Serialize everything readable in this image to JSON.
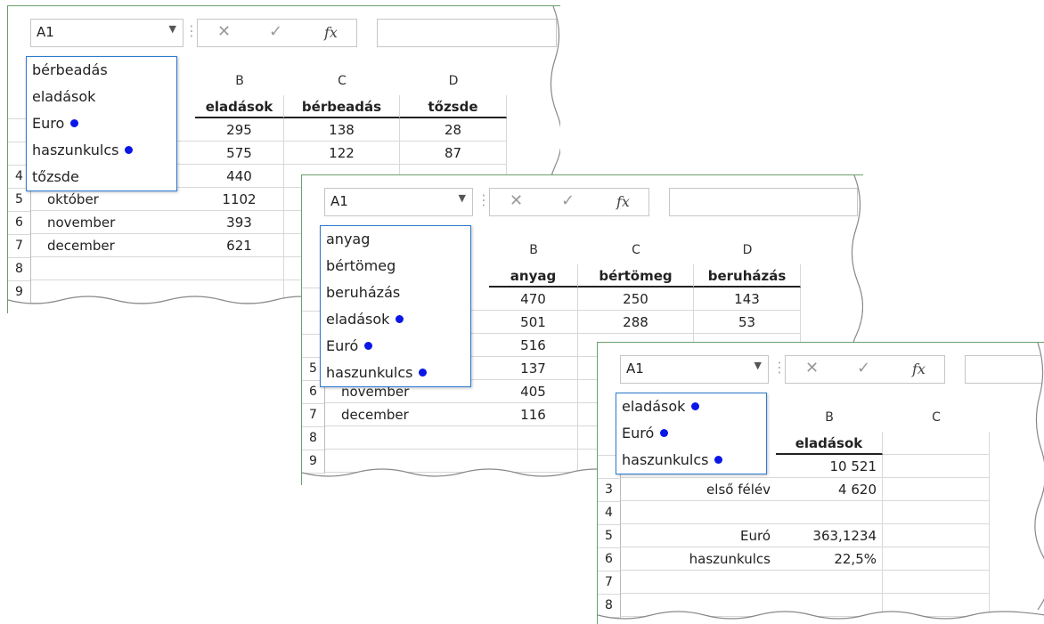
{
  "sheets": [
    {
      "namebox": "A1",
      "fx_label": "fx",
      "columns": [
        "B",
        "C",
        "D"
      ],
      "header_row": [
        "eladások",
        "bérbeadás",
        "tőzsde"
      ],
      "rows": [
        {
          "num": "",
          "label": "",
          "values": [
            "295",
            "138",
            "28"
          ]
        },
        {
          "num": "",
          "label": "",
          "values": [
            "575",
            "122",
            "87"
          ]
        },
        {
          "num": "4",
          "label": "",
          "values": [
            "440",
            "",
            ""
          ]
        },
        {
          "num": "5",
          "label": "október",
          "values": [
            "1102",
            "",
            ""
          ]
        },
        {
          "num": "6",
          "label": "november",
          "values": [
            "393",
            "",
            ""
          ]
        },
        {
          "num": "7",
          "label": "december",
          "values": [
            "621",
            "",
            ""
          ]
        },
        {
          "num": "8",
          "label": "",
          "values": [
            "",
            "",
            ""
          ]
        },
        {
          "num": "9",
          "label": "",
          "values": [
            "",
            "",
            ""
          ]
        }
      ],
      "dropdown": [
        {
          "label": "bérbeadás",
          "dot": false
        },
        {
          "label": "eladások",
          "dot": false
        },
        {
          "label": "Euro",
          "dot": true
        },
        {
          "label": "haszunkulcs",
          "dot": true
        },
        {
          "label": "tőzsde",
          "dot": false
        }
      ]
    },
    {
      "namebox": "A1",
      "fx_label": "fx",
      "columns": [
        "B",
        "C",
        "D"
      ],
      "header_row": [
        "anyag",
        "bértömeg",
        "beruházás"
      ],
      "rows": [
        {
          "num": "",
          "label": "",
          "values": [
            "470",
            "250",
            "143"
          ]
        },
        {
          "num": "",
          "label": "",
          "values": [
            "501",
            "288",
            "53"
          ]
        },
        {
          "num": "",
          "label": "",
          "values": [
            "516",
            "",
            ""
          ]
        },
        {
          "num": "5",
          "label": "",
          "values": [
            "137",
            "",
            ""
          ]
        },
        {
          "num": "6",
          "label": "november",
          "values": [
            "405",
            "",
            ""
          ]
        },
        {
          "num": "7",
          "label": "december",
          "values": [
            "116",
            "",
            ""
          ]
        },
        {
          "num": "8",
          "label": "",
          "values": [
            "",
            "",
            ""
          ]
        },
        {
          "num": "9",
          "label": "",
          "values": [
            "",
            "",
            ""
          ]
        }
      ],
      "dropdown": [
        {
          "label": "anyag",
          "dot": false
        },
        {
          "label": "bértömeg",
          "dot": false
        },
        {
          "label": "beruházás",
          "dot": false
        },
        {
          "label": "eladások",
          "dot": true
        },
        {
          "label": "Euró",
          "dot": true
        },
        {
          "label": "haszunkulcs",
          "dot": true
        }
      ]
    },
    {
      "namebox": "A1",
      "fx_label": "fx",
      "columns": [
        "B",
        "C"
      ],
      "header_row": [
        "eladások",
        ""
      ],
      "rows": [
        {
          "num": "",
          "label": "",
          "values": [
            "10 521",
            ""
          ]
        },
        {
          "num": "3",
          "label": "első félév",
          "values": [
            "4 620",
            ""
          ]
        },
        {
          "num": "4",
          "label": "",
          "values": [
            "",
            ""
          ]
        },
        {
          "num": "5",
          "label": "Euró",
          "values": [
            "363,1234",
            ""
          ]
        },
        {
          "num": "6",
          "label": "haszunkulcs",
          "values": [
            "22,5%",
            ""
          ]
        },
        {
          "num": "7",
          "label": "",
          "values": [
            "",
            ""
          ]
        },
        {
          "num": "8",
          "label": "",
          "values": [
            "",
            ""
          ]
        }
      ],
      "dropdown": [
        {
          "label": "eladások",
          "dot": true
        },
        {
          "label": "Euró",
          "dot": true
        },
        {
          "label": "haszunkulcs",
          "dot": true
        }
      ]
    }
  ],
  "colors": {
    "accent_blue": "#2b7bd1",
    "dot_blue": "#0a17e6",
    "sheet_border": "#6aa06a"
  }
}
